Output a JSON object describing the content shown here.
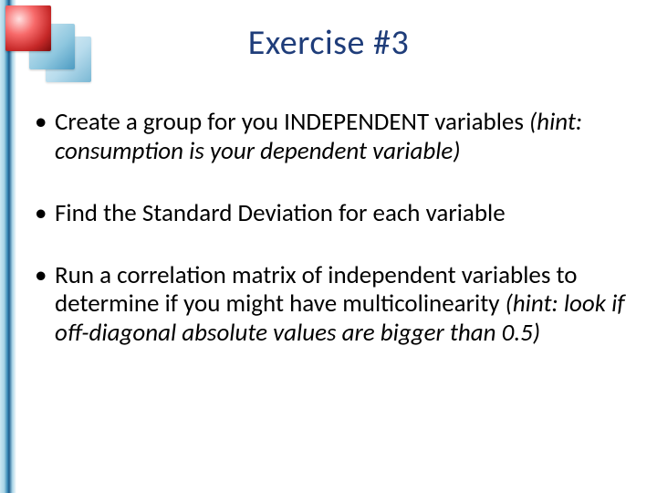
{
  "title": "Exercise #3",
  "bullets": [
    {
      "main": "Create a group for you INDEPENDENT variables ",
      "hint": "(hint: consumption is your dependent variable)"
    },
    {
      "main": "Find the Standard Deviation for each variable",
      "hint": ""
    },
    {
      "main": "Run a correlation matrix of independent variables to determine if you might have multicolinearity ",
      "hint": "(hint: look if off-diagonal absolute values are bigger than 0.5)"
    }
  ]
}
